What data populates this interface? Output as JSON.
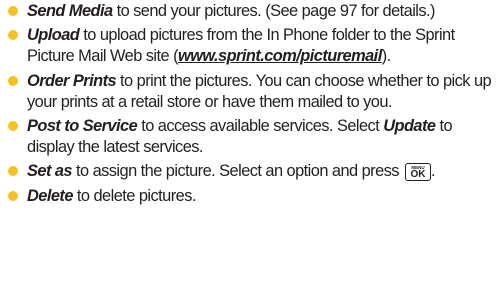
{
  "colors": {
    "bullet": "#f7c21b",
    "text": "#231f20"
  },
  "items": [
    {
      "term": "Send Media",
      "text": " to send your pictures. (See page 97 for details.)"
    },
    {
      "term": "Upload",
      "text": " to upload pictures from the In Phone folder to the Sprint Picture Mail Web site (",
      "link": "www.sprint.com/picturemail",
      "text_after": ")."
    },
    {
      "term": "Order Prints",
      "text": " to print the pictures. You can choose whether to pick up your prints at a retail store or have them mailed to you."
    },
    {
      "term": "Post to Service",
      "text": " to access available services. Select ",
      "term2": "Update",
      "text_after": " to display the latest services."
    },
    {
      "term": "Set as",
      "text": " to assign the picture. Select an option and press ",
      "key_top": "MENU",
      "key_main": "OK",
      "text_after": "."
    },
    {
      "term": "Delete",
      "text": " to delete pictures."
    }
  ]
}
